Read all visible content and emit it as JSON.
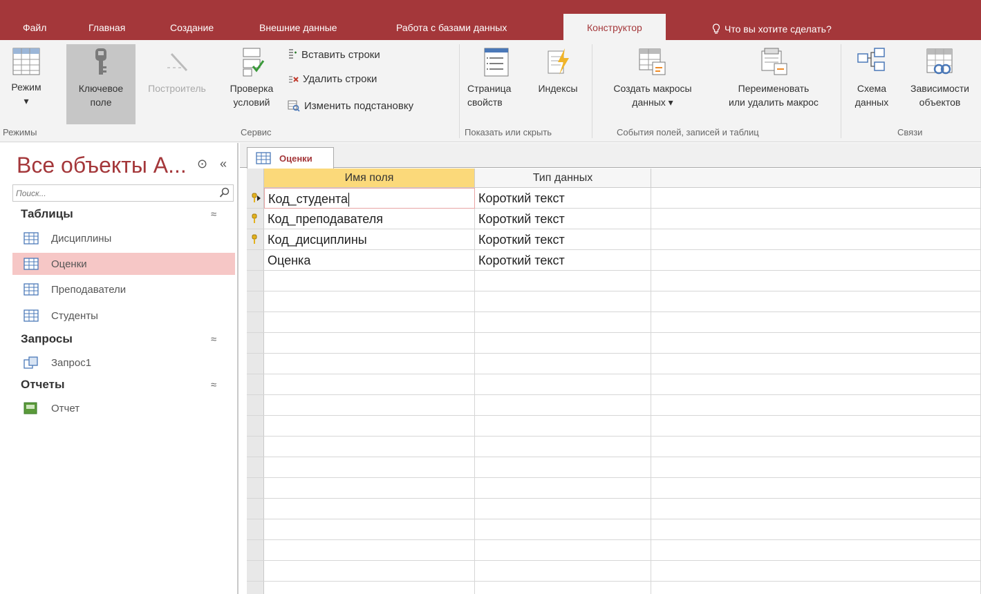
{
  "ribbon_tabs": [
    "Файл",
    "Главная",
    "Создание",
    "Внешние данные",
    "Работа с базами данных",
    "Конструктор"
  ],
  "tell_me": "Что вы хотите сделать?",
  "ribbon": {
    "mode": {
      "line1": "Режим",
      "arrow": "▾"
    },
    "key_field": {
      "line1": "Ключевое",
      "line2": "поле"
    },
    "builder": {
      "line1": "Построитель"
    },
    "validation": {
      "line1": "Проверка",
      "line2": "условий"
    },
    "insert_rows": "Вставить строки",
    "delete_rows": "Удалить строки",
    "change_lookup": "Изменить подстановку",
    "property_sheet": {
      "line1": "Страница",
      "line2": "свойств"
    },
    "indexes": {
      "line1": "Индексы"
    },
    "create_macros": {
      "line1": "Создать макросы",
      "line2": "данных ▾"
    },
    "rename_macro": {
      "line1": "Переименовать",
      "line2": "или удалить макрос"
    },
    "schema": {
      "line1": "Схема",
      "line2": "данных"
    },
    "dependencies": {
      "line1": "Зависимости",
      "line2": "объектов"
    },
    "groups": {
      "modes": "Режимы",
      "service": "Сервис",
      "show_hide": "Показать или скрыть",
      "events": "События полей, записей и таблиц",
      "relations": "Связи"
    }
  },
  "nav": {
    "title": "Все объекты A...",
    "search_placeholder": "Поиск...",
    "sections": [
      {
        "label": "Таблицы",
        "items": [
          "Дисциплины",
          "Оценки",
          "Преподаватели",
          "Студенты"
        ]
      },
      {
        "label": "Запросы",
        "items": [
          "Запрос1"
        ]
      },
      {
        "label": "Отчеты",
        "items": [
          "Отчет"
        ]
      }
    ],
    "selected": "Оценки"
  },
  "document": {
    "tab": "Оценки",
    "columns": [
      "Имя поля",
      "Тип данных",
      ""
    ],
    "rows": [
      {
        "name": "Код_студента",
        "type": "Короткий текст",
        "key": true,
        "current": true
      },
      {
        "name": "Код_преподавателя",
        "type": "Короткий текст",
        "key": true
      },
      {
        "name": "Код_дисциплины",
        "type": "Короткий текст",
        "key": true
      },
      {
        "name": "Оценка",
        "type": "Короткий текст",
        "key": false
      }
    ]
  },
  "colors": {
    "accent": "#a4373a",
    "active_header": "#fbd97a",
    "selected_nav": "#f6c7c6"
  }
}
